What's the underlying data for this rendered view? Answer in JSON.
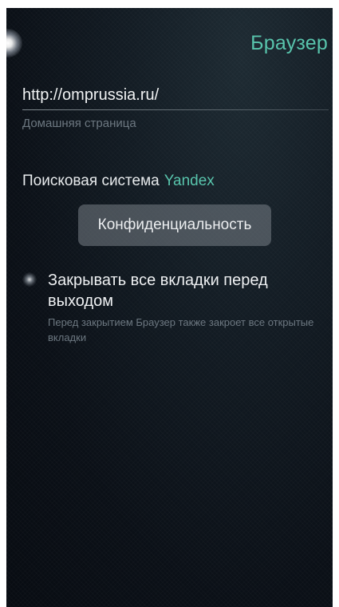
{
  "header": {
    "title": "Браузер"
  },
  "homepage": {
    "value": "http://omprussia.ru/",
    "label": "Домашняя страница"
  },
  "search_engine": {
    "label": "Поисковая система",
    "value": "Yandex"
  },
  "privacy_button": {
    "label": "Конфиденциальность"
  },
  "close_tabs": {
    "label": "Закрывать все вкладки перед выходом",
    "description": "Перед закрытием Браузер также закроет все открытые вкладки",
    "checked": false
  },
  "colors": {
    "accent": "#58c4ac",
    "primary_text": "#eef0f2",
    "secondary_text": "#6c7780",
    "background": "#0b1017"
  }
}
